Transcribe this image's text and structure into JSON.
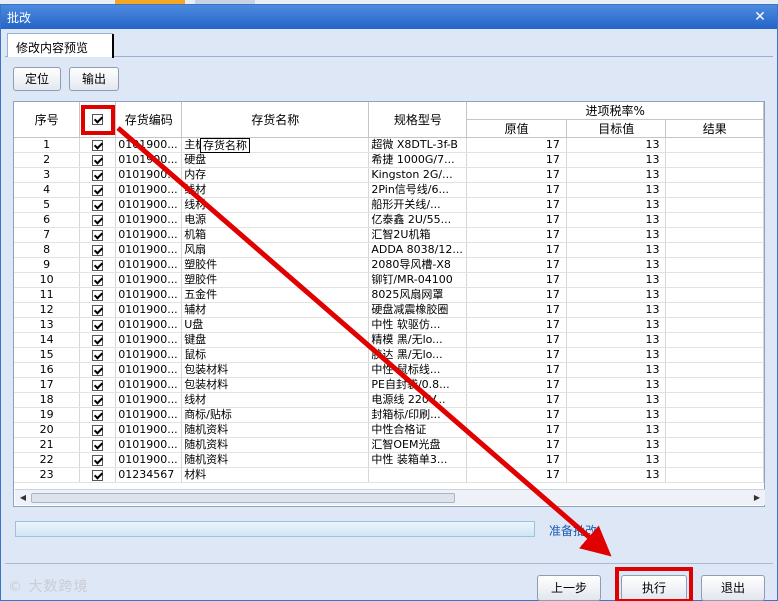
{
  "window": {
    "title": "批改",
    "close_glyph": "✕"
  },
  "tab": {
    "label": "修改内容预览"
  },
  "toolbar": {
    "locate_label": "定位",
    "export_label": "输出"
  },
  "table": {
    "headers": {
      "seq": "序号",
      "code": "存货编码",
      "name": "存货名称",
      "spec": "规格型号",
      "tax_group": "进项税率%",
      "orig": "原值",
      "target": "目标值",
      "result": "结果"
    },
    "rows": [
      {
        "seq": "1",
        "code": "0101900...",
        "name": "主板",
        "spec": "超微 X8DTL-3f-B",
        "orig": "17",
        "target": "13",
        "result": ""
      },
      {
        "seq": "2",
        "code": "0101900...",
        "name": "硬盘",
        "spec": "希捷 1000G/7...",
        "orig": "17",
        "target": "13",
        "result": ""
      },
      {
        "seq": "3",
        "code": "0101900...",
        "name": "内存",
        "spec": "Kingston 2G/...",
        "orig": "17",
        "target": "13",
        "result": ""
      },
      {
        "seq": "4",
        "code": "0101900...",
        "name": "线材",
        "spec": "2Pin信号线/6...",
        "orig": "17",
        "target": "13",
        "result": ""
      },
      {
        "seq": "5",
        "code": "0101900...",
        "name": "线材",
        "spec": "船形开关线/...",
        "orig": "17",
        "target": "13",
        "result": ""
      },
      {
        "seq": "6",
        "code": "0101900...",
        "name": "电源",
        "spec": "亿泰鑫 2U/55...",
        "orig": "17",
        "target": "13",
        "result": ""
      },
      {
        "seq": "7",
        "code": "0101900...",
        "name": "机箱",
        "spec": "汇智2U机箱",
        "orig": "17",
        "target": "13",
        "result": ""
      },
      {
        "seq": "8",
        "code": "0101900...",
        "name": "风扇",
        "spec": "ADDA 8038/12...",
        "orig": "17",
        "target": "13",
        "result": ""
      },
      {
        "seq": "9",
        "code": "0101900...",
        "name": "塑胶件",
        "spec": "2080导风槽-X8",
        "orig": "17",
        "target": "13",
        "result": ""
      },
      {
        "seq": "10",
        "code": "0101900...",
        "name": "塑胶件",
        "spec": "铆钉/MR-04100",
        "orig": "17",
        "target": "13",
        "result": ""
      },
      {
        "seq": "11",
        "code": "0101900...",
        "name": "五金件",
        "spec": "8025风扇网罩",
        "orig": "17",
        "target": "13",
        "result": ""
      },
      {
        "seq": "12",
        "code": "0101900...",
        "name": "辅材",
        "spec": "硬盘减震橡胶圈",
        "orig": "17",
        "target": "13",
        "result": ""
      },
      {
        "seq": "13",
        "code": "0101900...",
        "name": "U盘",
        "spec": "中性 软驱仿...",
        "orig": "17",
        "target": "13",
        "result": ""
      },
      {
        "seq": "14",
        "code": "0101900...",
        "name": "键盘",
        "spec": "精模 黑/无lo...",
        "orig": "17",
        "target": "13",
        "result": ""
      },
      {
        "seq": "15",
        "code": "0101900...",
        "name": "鼠标",
        "spec": "胶达 黑/无lo...",
        "orig": "17",
        "target": "13",
        "result": ""
      },
      {
        "seq": "16",
        "code": "0101900...",
        "name": "包装材料",
        "spec": "中性 鼠标线...",
        "orig": "17",
        "target": "13",
        "result": ""
      },
      {
        "seq": "17",
        "code": "0101900...",
        "name": "包装材料",
        "spec": "PE自封袋/0.8...",
        "orig": "17",
        "target": "13",
        "result": ""
      },
      {
        "seq": "18",
        "code": "0101900...",
        "name": "线材",
        "spec": "电源线 220V...",
        "orig": "17",
        "target": "13",
        "result": ""
      },
      {
        "seq": "19",
        "code": "0101900...",
        "name": "商标/贴标",
        "spec": "封箱标/印刷...",
        "orig": "17",
        "target": "13",
        "result": ""
      },
      {
        "seq": "20",
        "code": "0101900...",
        "name": "随机资料",
        "spec": "中性合格证",
        "orig": "17",
        "target": "13",
        "result": ""
      },
      {
        "seq": "21",
        "code": "0101900...",
        "name": "随机资料",
        "spec": "汇智OEM光盘",
        "orig": "17",
        "target": "13",
        "result": ""
      },
      {
        "seq": "22",
        "code": "0101900...",
        "name": "随机资料",
        "spec": "中性 装箱单3...",
        "orig": "17",
        "target": "13",
        "result": ""
      },
      {
        "seq": "23",
        "code": "01234567",
        "name": "材料",
        "spec": "",
        "orig": "17",
        "target": "13",
        "result": ""
      }
    ]
  },
  "tooltip": {
    "text": "存货名称"
  },
  "status": {
    "text": "准备批改"
  },
  "buttons": {
    "prev_label": "上一步",
    "execute_label": "执行",
    "exit_label": "退出"
  },
  "watermark": {
    "text": "© 大数跨境"
  },
  "colors": {
    "highlight": "#e00000",
    "title_bar": "#2f6fd0",
    "status_text": "#1a5fb4"
  }
}
